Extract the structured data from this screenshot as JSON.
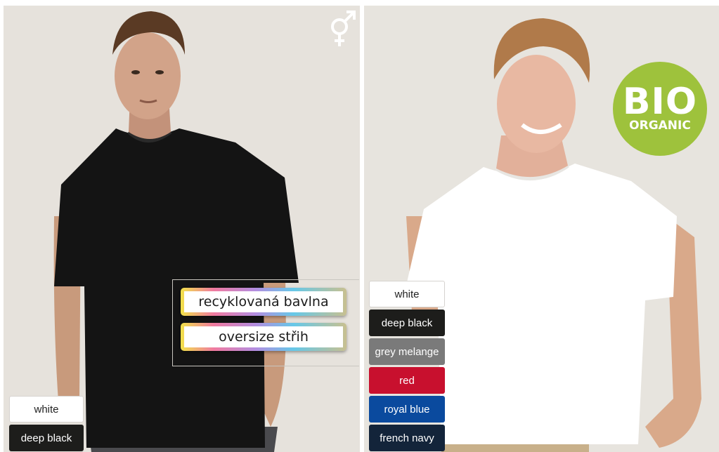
{
  "left_panel": {
    "features": [
      "recyklovaná bavlna",
      "oversize střih"
    ],
    "colors": [
      {
        "label": "white",
        "hex": "#ffffff"
      },
      {
        "label": "deep black",
        "hex": "#1d1d1b"
      }
    ],
    "icon": "unisex-gender-icon"
  },
  "right_panel": {
    "badge": {
      "main": "BIO",
      "sub": "ORGANIC",
      "color": "#9ec23c"
    },
    "colors": [
      {
        "label": "white",
        "hex": "#ffffff"
      },
      {
        "label": "deep black",
        "hex": "#1d1d1b"
      },
      {
        "label": "grey melange",
        "hex": "#7a7a7a"
      },
      {
        "label": "red",
        "hex": "#c8102e"
      },
      {
        "label": "royal blue",
        "hex": "#0a4a9e"
      },
      {
        "label": "french navy",
        "hex": "#13243a"
      }
    ]
  }
}
